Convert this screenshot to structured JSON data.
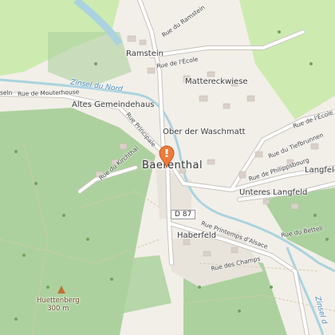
{
  "map": {
    "labels": {
      "ramstein": "Ramstein",
      "mattereckwiese": "Mattereckwiese",
      "altes_gemeindehaus": "Altes Gemeindehaus",
      "ober_der_waschmatt": "Ober der Waschmatt",
      "baerenthal": "Baerenthal",
      "langfeld": "Langfeld",
      "unteres_langfeld": "Unteres Langfeld",
      "haberfeld": "Haberfeld",
      "huettenberg": "Huettenberg",
      "huettenberg_elev": "300 m"
    },
    "water": {
      "zinsel_du_nord": "Zinsel du Nord",
      "zinsel_right": "Zinsel d"
    },
    "streets": {
      "rue_du_ramstein": "Rue du Ramstein",
      "rue_de_lecole_top": "Rue de l'École",
      "rue_de_lecole_right": "Rue de l'École",
      "rue_de_mouterhouse": "Rue de Mouterhouse",
      "rue_principale": "Rue Principale",
      "rue_du_kirchthal": "Rue du Kirchthal",
      "rue_du_tiefbrunnen": "Rue du Tiefbrunnen",
      "rue_de_philippsbourg": "Rue de Philippsbourg",
      "rue_du_betteli": "Rue du Betteli",
      "rue_printemps_dalsace": "Rue Printemps d'Alsace",
      "rue_des_champs": "Rue des Champs",
      "left_cut": "seln"
    },
    "road_refs": {
      "d87": "D 87"
    },
    "icons": [
      "location-pin-icon",
      "peak-icon",
      "tree-icon"
    ],
    "colors": {
      "background": "#f2efe9",
      "forest": "#add19e",
      "meadow": "#cdebb0",
      "water": "#aad3df",
      "road": "#ffffff",
      "marker": "#ef7a3a"
    }
  }
}
